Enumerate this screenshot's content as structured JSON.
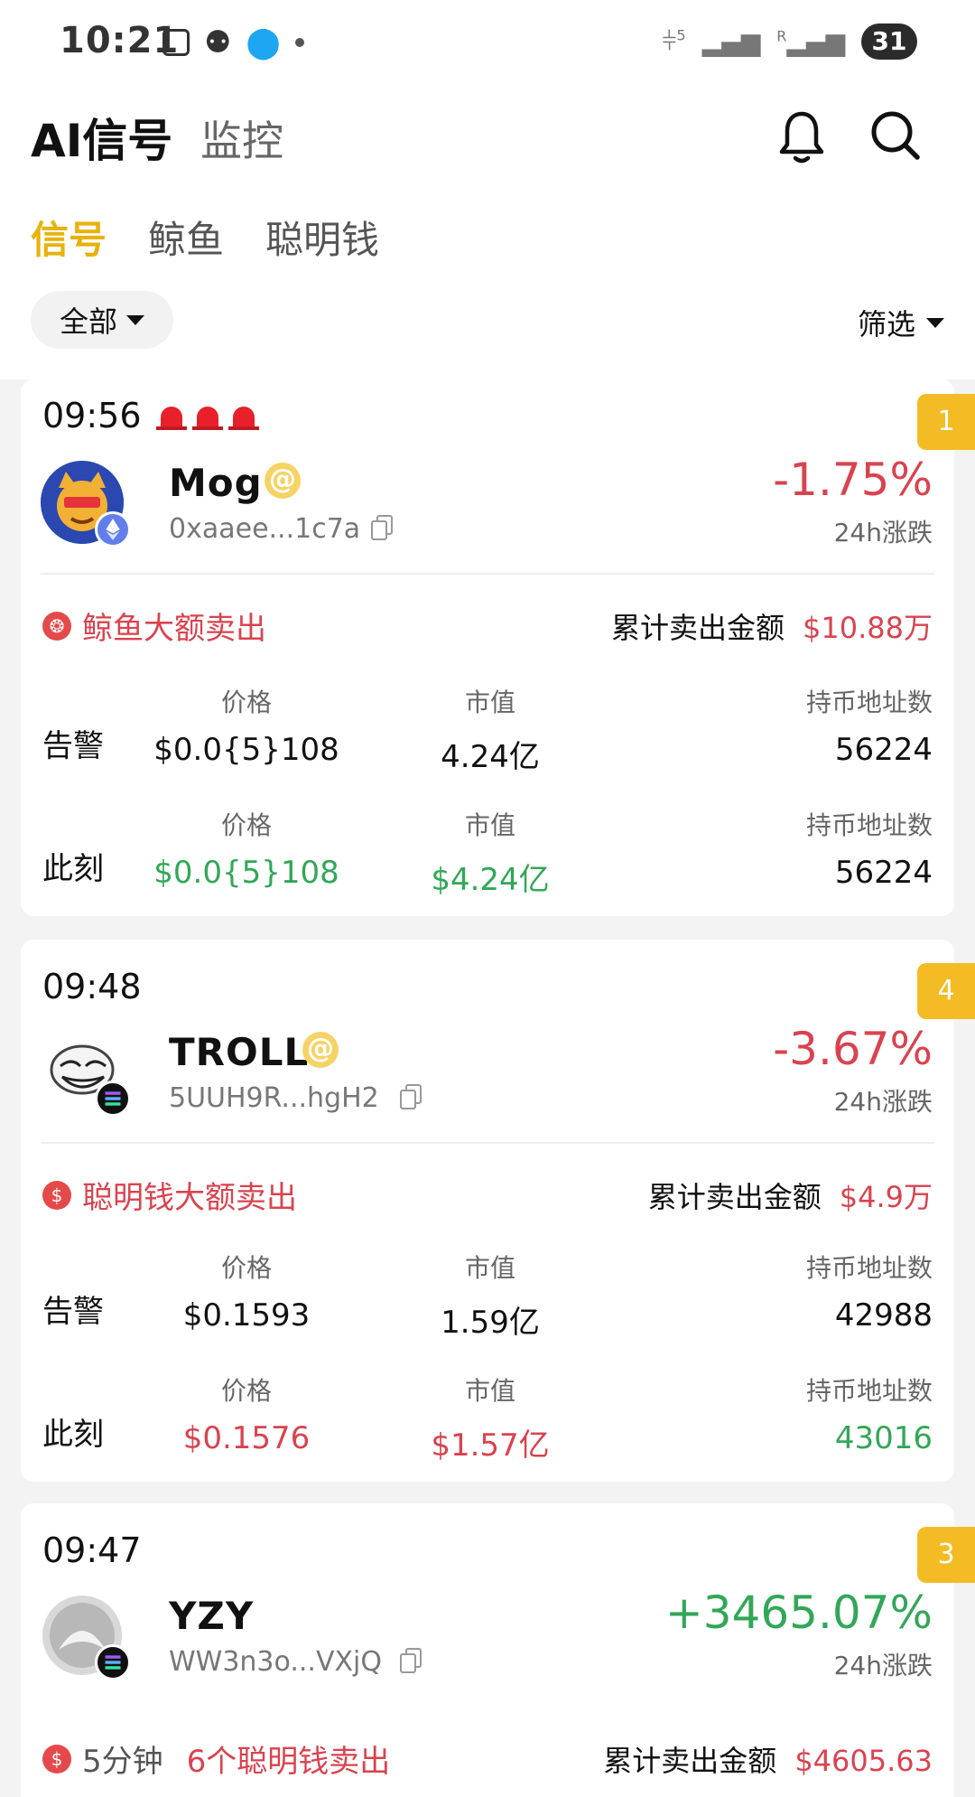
{
  "status_bar": {
    "time": "10:21",
    "battery": "31",
    "signal_a": "5",
    "signal_b": "R"
  },
  "header": {
    "title": "AI信号",
    "subtitle": "监控"
  },
  "tabs": [
    {
      "label": "信号",
      "active": true
    },
    {
      "label": "鲸鱼",
      "active": false
    },
    {
      "label": "聪明钱",
      "active": false
    }
  ],
  "filters": {
    "all": "全部",
    "filter": "筛选"
  },
  "labels": {
    "change_24h": "24h涨跌",
    "cum_sell": "累计卖出金额",
    "alert": "告警",
    "now": "此刻",
    "price": "价格",
    "mcap": "市值",
    "holders": "持币地址数"
  },
  "cards": [
    {
      "time": "09:56",
      "rank": "1",
      "name": "Mog",
      "address": "0xaaee...1c7a",
      "change": "-1.75%",
      "event": "鲸鱼大额卖出",
      "cum_value": "$10.88万",
      "alert": {
        "price": "$0.0{5}108",
        "mcap": "4.24亿",
        "holders": "56224"
      },
      "now": {
        "price": "$0.0{5}108",
        "mcap": "$4.24亿",
        "holders": "56224"
      }
    },
    {
      "time": "09:48",
      "rank": "4",
      "name": "TROLL",
      "address": "5UUH9R...hgH2",
      "change": "-3.67%",
      "event": "聪明钱大额卖出",
      "cum_value": "$4.9万",
      "alert": {
        "price": "$0.1593",
        "mcap": "1.59亿",
        "holders": "42988"
      },
      "now": {
        "price": "$0.1576",
        "mcap": "$1.57亿",
        "holders": "43016"
      }
    },
    {
      "time": "09:47",
      "rank": "3",
      "name": "YZY",
      "address": "WW3n3o...VXjQ",
      "change": "+3465.07%",
      "event_prefix": "5分钟",
      "event": "6个聪明钱卖出",
      "cum_value": "$4605.63"
    }
  ],
  "colors": {
    "accent": "#e8b20d",
    "red": "#d9434f",
    "green": "#32a758",
    "rank_bg": "#f3bc24"
  }
}
